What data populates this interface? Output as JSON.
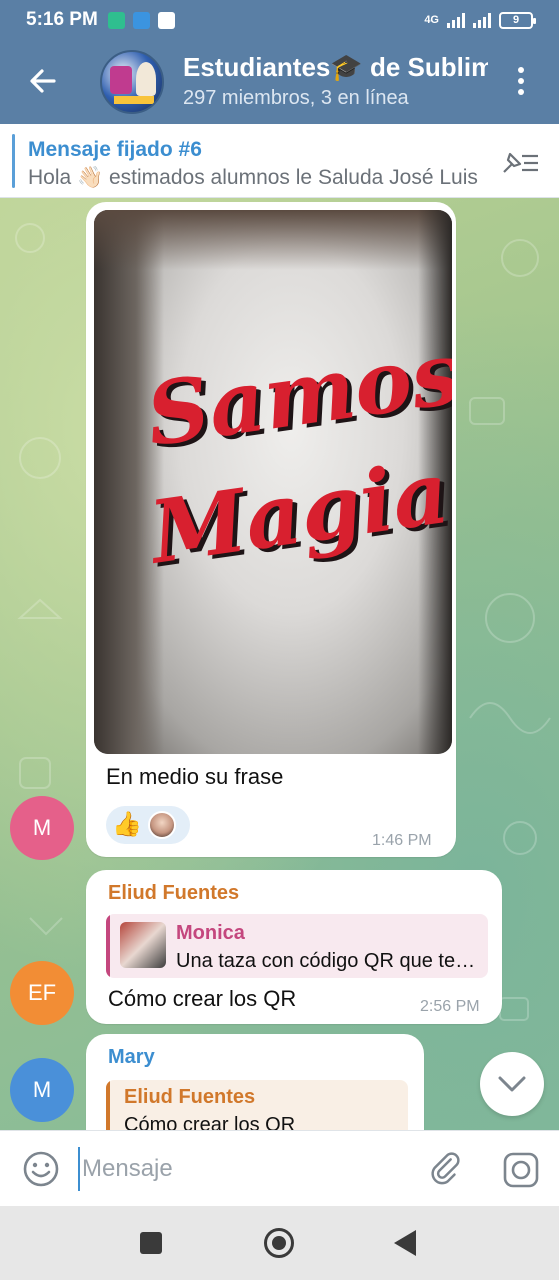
{
  "status_bar": {
    "time": "5:16 PM",
    "network": "4G",
    "battery": "9"
  },
  "header": {
    "title": "Estudiantes🎓 de Sublim",
    "subtitle": "297 miembros, 3 en línea"
  },
  "pinned": {
    "title": "Mensaje fijado #6",
    "text": "Hola 👋🏻 estimados alumnos le Saluda José Luis"
  },
  "messages": {
    "photo_message": {
      "mug_text_line1": "Samos",
      "mug_text_line2": "Magia",
      "caption": "En medio su frase",
      "reaction": "👍",
      "time": "1:46 PM",
      "avatar_initials": "M",
      "avatar_color": "#e5608a"
    },
    "reply_message": {
      "sender": "Eliud Fuentes",
      "sender_color": "#d1782b",
      "quote_name": "Monica",
      "quote_text": "Una taza con código QR que te lleve",
      "quote_color": "#c4477e",
      "text": "Cómo crear los QR",
      "time": "2:56 PM",
      "avatar_initials": "EF",
      "avatar_color": "#f28d35"
    },
    "mary_message": {
      "sender": "Mary",
      "sender_color": "#3c8ed0",
      "quote_name": "Eliud Fuentes",
      "quote_text": "Cómo crear los QR",
      "quote_color": "#d1782b",
      "avatar_initials": "M",
      "avatar_color": "#4a90d9"
    }
  },
  "input": {
    "placeholder": "Mensaje"
  },
  "icons": [
    "back-arrow-icon",
    "more-icon",
    "pinned-list-icon",
    "emoji-icon",
    "attach-icon",
    "camera-icon",
    "chevron-down-icon"
  ],
  "colors": {
    "header_bg": "#5a7fa5",
    "accent": "#3c8ed0"
  }
}
